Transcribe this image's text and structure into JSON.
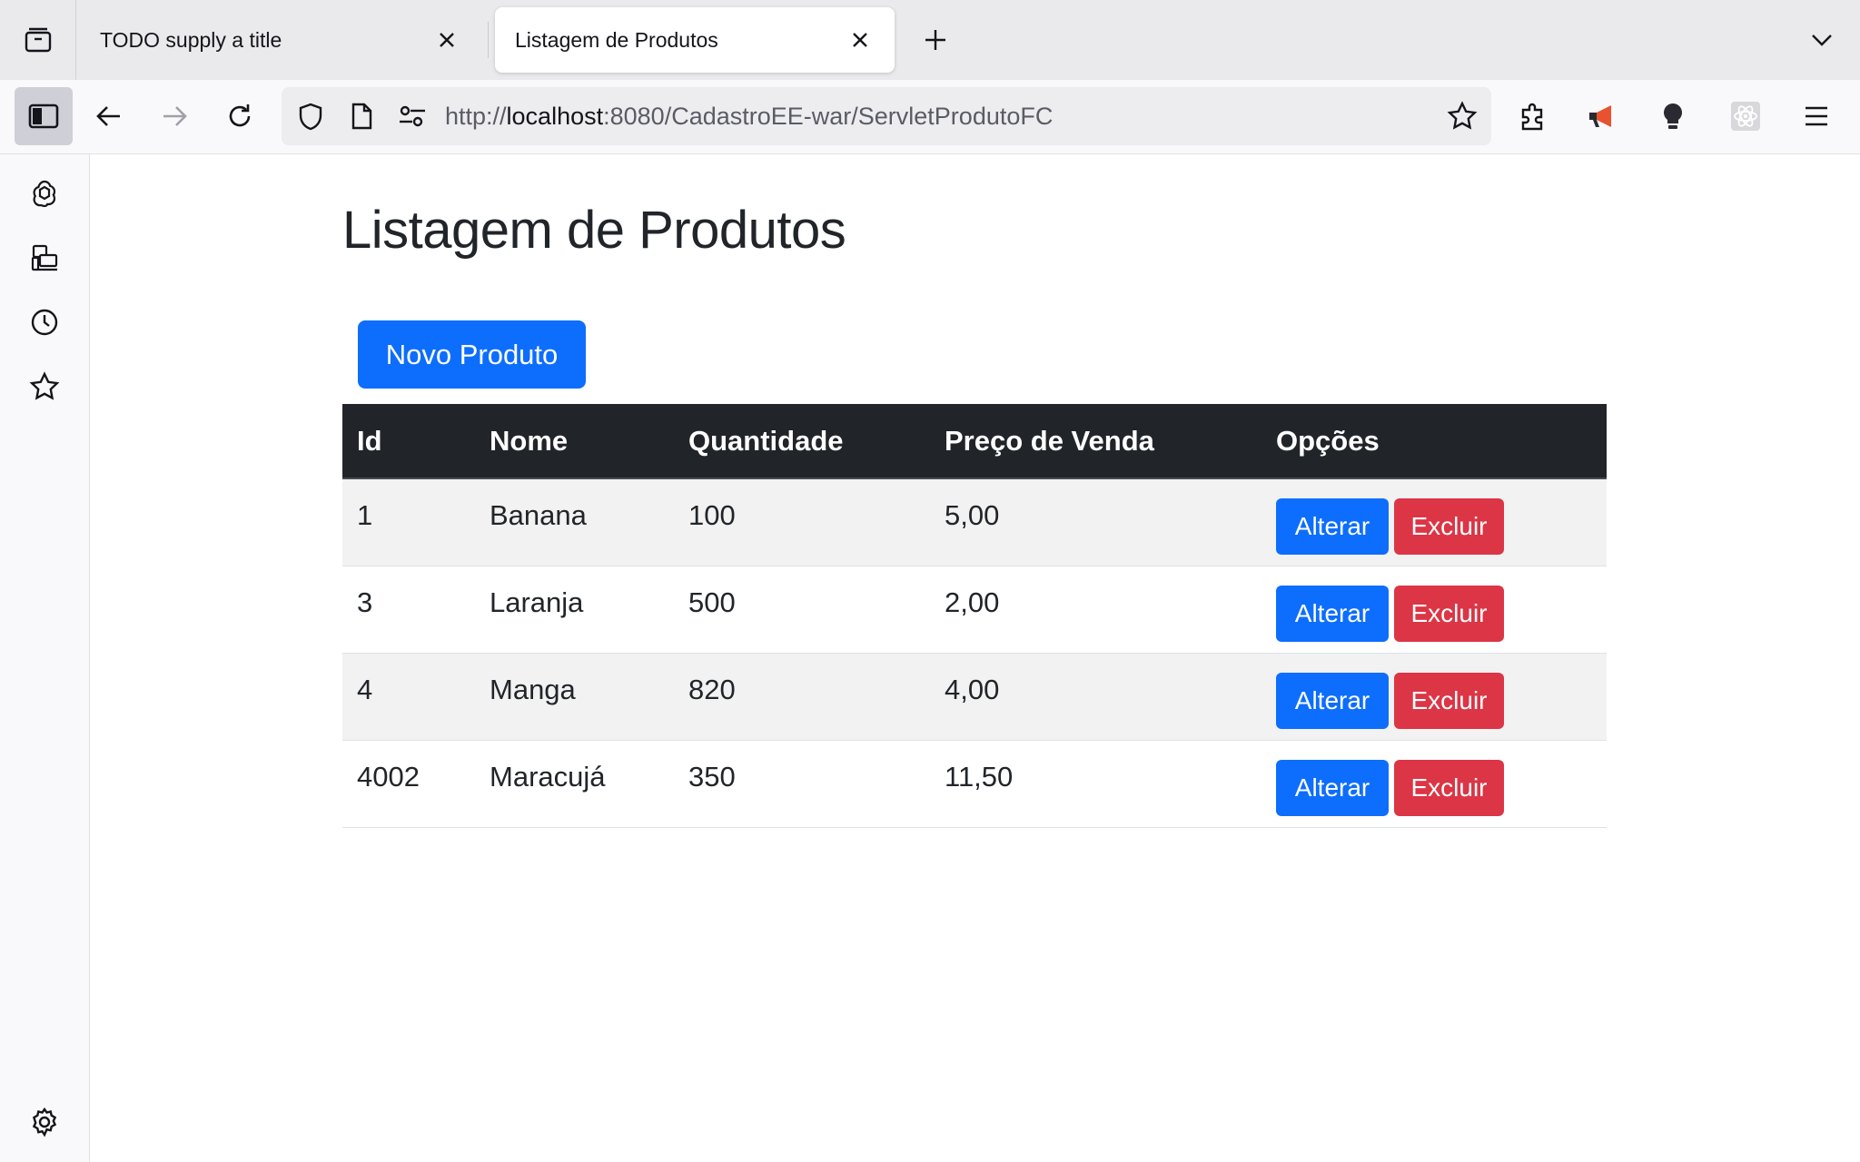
{
  "browser": {
    "tabs": [
      {
        "title": "TODO supply a title",
        "active": false
      },
      {
        "title": "Listagem de Produtos",
        "active": true
      }
    ],
    "url": {
      "scheme": "http://",
      "host": "localhost",
      "rest": ":8080/CadastroEE-war/ServletProdutoFC"
    }
  },
  "page": {
    "title": "Listagem de Produtos",
    "new_button": "Novo Produto",
    "table": {
      "headers": [
        "Id",
        "Nome",
        "Quantidade",
        "Preço de Venda",
        "Opções"
      ],
      "rows": [
        {
          "id": "1",
          "nome": "Banana",
          "quantidade": "100",
          "preco": "5,00"
        },
        {
          "id": "3",
          "nome": "Laranja",
          "quantidade": "500",
          "preco": "2,00"
        },
        {
          "id": "4",
          "nome": "Manga",
          "quantidade": "820",
          "preco": "4,00"
        },
        {
          "id": "4002",
          "nome": "Maracujá",
          "quantidade": "350",
          "preco": "11,50"
        }
      ],
      "edit_label": "Alterar",
      "delete_label": "Excluir"
    }
  },
  "colors": {
    "primary": "#0d6efd",
    "danger": "#dc3545",
    "table_header": "#212529",
    "stripe": "#f2f2f2"
  }
}
